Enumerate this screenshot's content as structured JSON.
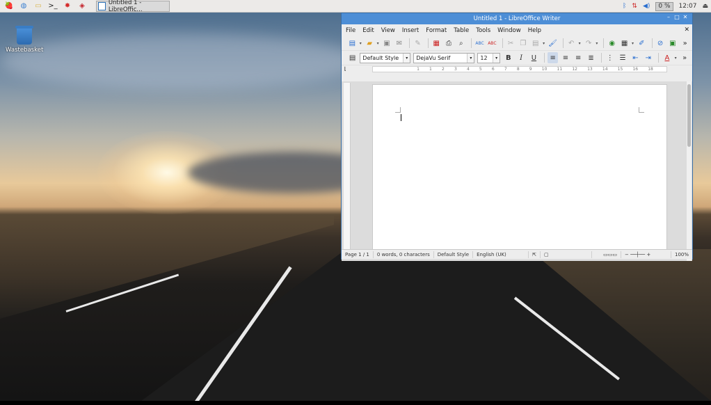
{
  "taskbar": {
    "launchers": [
      {
        "name": "raspberry-menu-icon",
        "glyph": "🍓",
        "color": "#c51a4a"
      },
      {
        "name": "web-browser-icon",
        "glyph": "◍",
        "color": "#3b7fd1"
      },
      {
        "name": "file-manager-icon",
        "glyph": "▭",
        "color": "#d9b44a"
      },
      {
        "name": "terminal-icon",
        "glyph": ">_",
        "color": "#222222"
      },
      {
        "name": "math-app-icon",
        "glyph": "✸",
        "color": "#d42a2a"
      },
      {
        "name": "wolfram-icon",
        "glyph": "◈",
        "color": "#c4232b"
      }
    ],
    "task_label": "Untitled 1 - LibreOffic...",
    "cpu_label": "0 %",
    "clock": "12:07"
  },
  "desktop": {
    "wastebasket_label": "Wastebasket"
  },
  "writer": {
    "title": "Untitled 1 - LibreOffice Writer",
    "menu": [
      "File",
      "Edit",
      "View",
      "Insert",
      "Format",
      "Table",
      "Tools",
      "Window",
      "Help"
    ],
    "style": "Default Style",
    "font": "DejaVu Serif",
    "size": "12",
    "ruler_marks": [
      "1",
      "1",
      "2",
      "3",
      "4",
      "5",
      "6",
      "7",
      "8",
      "9",
      "10",
      "11",
      "12",
      "13",
      "14",
      "15",
      "16",
      "18"
    ],
    "status": {
      "page": "Page 1 / 1",
      "words": "0 words, 0 characters",
      "style": "Default Style",
      "language": "English (UK)",
      "zoom": "100%"
    }
  }
}
